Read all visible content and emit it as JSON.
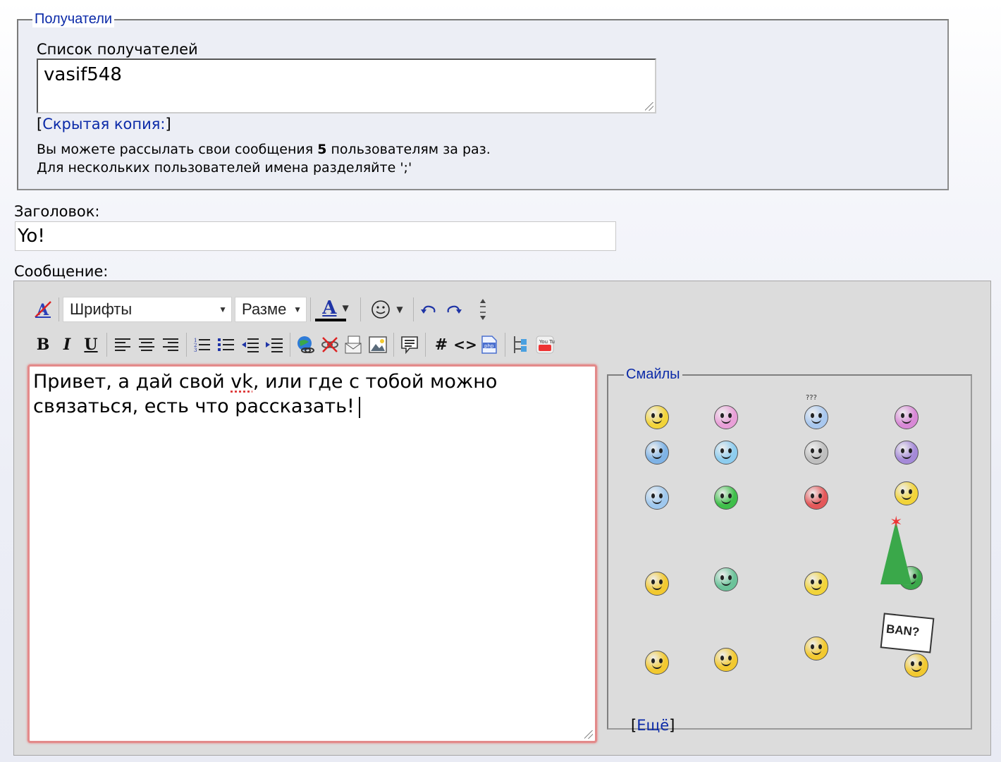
{
  "recipients": {
    "legend": "Получатели",
    "list_label": "Список получателей",
    "list_value": "vasif548",
    "bcc_open": "[",
    "bcc_link": "Скрытая копия:",
    "bcc_close": "]",
    "note_line1_pre": "Вы можете рассылать свои сообщения ",
    "note_line1_num": "5",
    "note_line1_post": " пользователям за раз.",
    "note_line2": "Для нескольких пользователей имена разделяйте ';'"
  },
  "subject": {
    "label": "Заголовок:",
    "value": "Yo!"
  },
  "message": {
    "label": "Сообщение:",
    "text_part1": "Привет, а дай свой ",
    "text_misspelled": "vk",
    "text_part2": ", или где с тобой можно связаться, есть что рассказать!"
  },
  "toolbar": {
    "font_select": "Шрифты",
    "size_select": "Разме",
    "font_color_glyph": "A",
    "bold": "B",
    "italic": "I",
    "underline": "U",
    "hash": "#",
    "code": "<>",
    "php": "php",
    "youtube": "You Tube"
  },
  "smileys": {
    "legend": "Смайлы",
    "more_open": "[",
    "more_link": "Ещё",
    "more_close": "]",
    "ban_sign": "BAN?",
    "question_marks": "???",
    "items": [
      {
        "name": "smile",
        "color": "#f2d43a"
      },
      {
        "name": "blush",
        "color": "#e9a0d8"
      },
      {
        "name": "confused",
        "color": "#a9c8ef"
      },
      {
        "name": "pink-happy",
        "color": "#d889d6"
      },
      {
        "name": "blue-grin",
        "color": "#7fb3e6"
      },
      {
        "name": "wink-blue",
        "color": "#8ecdef"
      },
      {
        "name": "shocked",
        "color": "#bfbfbf"
      },
      {
        "name": "sad-purple",
        "color": "#a58ad8"
      },
      {
        "name": "cool",
        "color": "#9fc8ee"
      },
      {
        "name": "green-grin",
        "color": "#3fbf4a"
      },
      {
        "name": "angry",
        "color": "#e4585a"
      },
      {
        "name": "angel",
        "color": "#f2d43a"
      },
      {
        "name": "laugh-point",
        "color": "#f2c930"
      },
      {
        "name": "green-alien",
        "color": "#6cc39a"
      },
      {
        "name": "scared",
        "color": "#f2d43a"
      },
      {
        "name": "xmas",
        "color": "#3aa84a"
      },
      {
        "name": "facepalm",
        "color": "#f2c930"
      },
      {
        "name": "crazy",
        "color": "#f2c930"
      },
      {
        "name": "dance",
        "color": "#f2c930"
      },
      {
        "name": "ban",
        "color": "#f2c930"
      }
    ]
  }
}
